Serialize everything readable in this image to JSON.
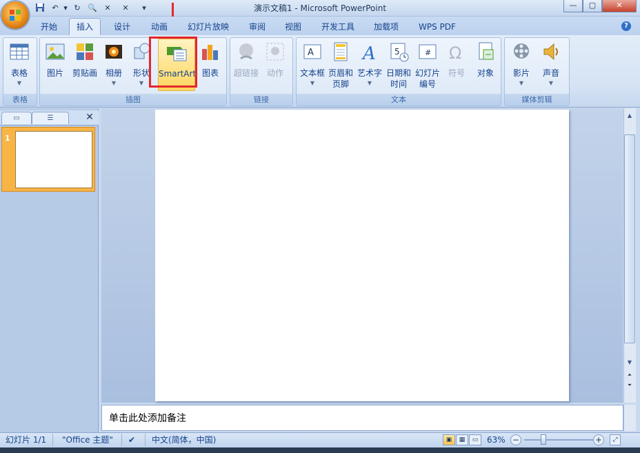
{
  "window": {
    "title": "演示文稿1 - Microsoft PowerPoint"
  },
  "tabs": [
    "开始",
    "插入",
    "设计",
    "动画",
    "幻灯片放映",
    "审阅",
    "视图",
    "开发工具",
    "加载项",
    "WPS PDF"
  ],
  "active_tab": "插入",
  "ribbon": {
    "groups": {
      "table": "表格",
      "illustrations": "插图",
      "links": "链接",
      "text": "文本",
      "media": "媒体剪辑"
    },
    "buttons": {
      "table": "表格",
      "picture": "图片",
      "clipart": "剪贴画",
      "album": "相册",
      "shapes": "形状",
      "smartart": "SmartArt",
      "chart": "图表",
      "hyperlink": "超链接",
      "action": "动作",
      "textbox": "文本框",
      "header_footer_1": "页眉和",
      "header_footer_2": "页脚",
      "wordart": "艺术字",
      "datetime_1": "日期和",
      "datetime_2": "时间",
      "slide_number_1": "幻灯片",
      "slide_number_2": "编号",
      "symbol": "符号",
      "object": "对象",
      "movie": "影片",
      "sound": "声音"
    },
    "highlighted": "SmartArt"
  },
  "slides_panel": {
    "thumbnail_number": "1"
  },
  "notes": {
    "placeholder": "单击此处添加备注"
  },
  "status": {
    "slide": "幻灯片 1/1",
    "theme": "\"Office 主题\"",
    "language": "中文(简体，中国)",
    "zoom": "63%"
  },
  "colors": {
    "highlight": "#e6262b",
    "active_button": "#ffd65e",
    "ribbon": "#dce8f7"
  }
}
